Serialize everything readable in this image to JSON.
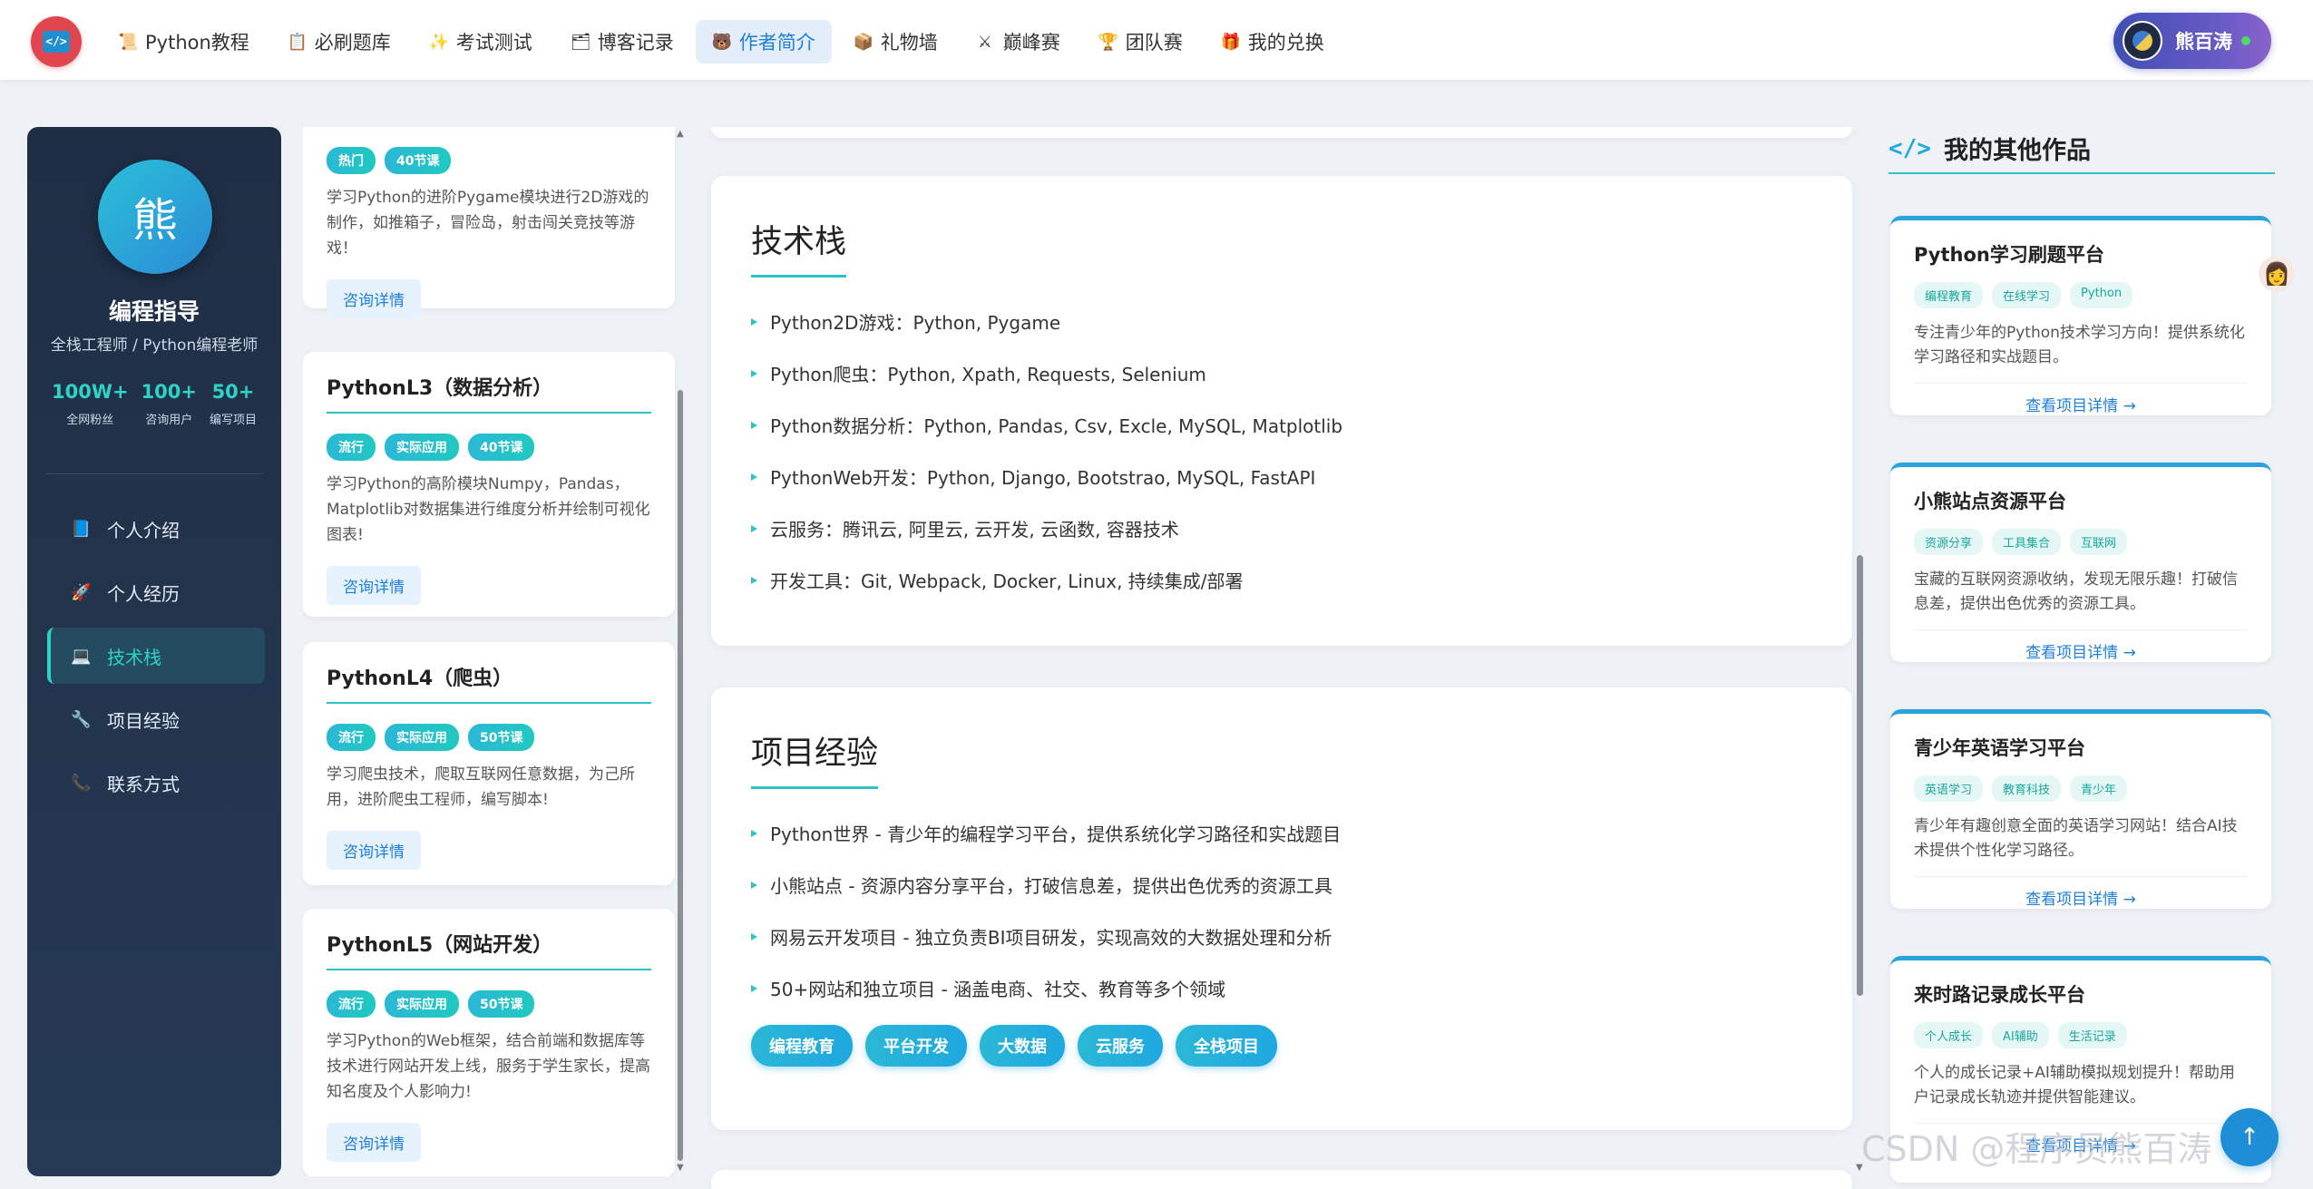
{
  "nav": {
    "logo": "</>",
    "items": [
      {
        "label": "Python教程",
        "icon": "📜"
      },
      {
        "label": "必刷题库",
        "icon": "📋"
      },
      {
        "label": "考试测试",
        "icon": "✨"
      },
      {
        "label": "博客记录",
        "icon": "🗂"
      },
      {
        "label": "作者简介",
        "icon": "🐻"
      },
      {
        "label": "礼物墙",
        "icon": "📦"
      },
      {
        "label": "巅峰赛",
        "icon": "⚔"
      },
      {
        "label": "团队赛",
        "icon": "🏆"
      },
      {
        "label": "我的兑换",
        "icon": "🎁"
      }
    ],
    "active_index": 4,
    "user_name": "熊百涛"
  },
  "profile": {
    "avatar_char": "熊",
    "name": "编程指导",
    "title": "全栈工程师 / Python编程老师",
    "stats": [
      {
        "num": "100W+",
        "label": "全网粉丝"
      },
      {
        "num": "100+",
        "label": "咨询用户"
      },
      {
        "num": "50+",
        "label": "编写项目"
      }
    ],
    "menu": [
      {
        "label": "个人介绍",
        "icon": "📘"
      },
      {
        "label": "个人经历",
        "icon": "🚀"
      },
      {
        "label": "技术栈",
        "icon": "💻"
      },
      {
        "label": "项目经验",
        "icon": "🔧"
      },
      {
        "label": "联系方式",
        "icon": "📞"
      }
    ],
    "active_menu": 2
  },
  "courses": {
    "partial": {
      "tags": [
        "热门",
        "40节课"
      ],
      "desc": "学习Python的进阶Pygame模块进行2D游戏的制作，如推箱子，冒险岛，射击闯关竞技等游戏！",
      "button": "咨询详情"
    },
    "items": [
      {
        "title": "PythonL3（数据分析）",
        "tags": [
          "流行",
          "实际应用",
          "40节课"
        ],
        "desc": "学习Python的高阶模块Numpy，Pandas，Matplotlib对数据集进行维度分析并绘制可视化图表!",
        "button": "咨询详情"
      },
      {
        "title": "PythonL4（爬虫）",
        "tags": [
          "流行",
          "实际应用",
          "50节课"
        ],
        "desc": "学习爬虫技术，爬取互联网任意数据，为己所用，进阶爬虫工程师，编写脚本!",
        "button": "咨询详情"
      },
      {
        "title": "PythonL5（网站开发）",
        "tags": [
          "流行",
          "实际应用",
          "50节课"
        ],
        "desc": "学习Python的Web框架，结合前端和数据库等技术进行网站开发上线，服务于学生家长，提高知名度及个人影响力!",
        "button": "咨询详情"
      }
    ]
  },
  "tech": {
    "title": "技术栈",
    "items": [
      "Python2D游戏：Python, Pygame",
      "Python爬虫：Python, Xpath, Requests, Selenium",
      "Python数据分析：Python, Pandas, Csv, Excle, MySQL, Matplotlib",
      "PythonWeb开发：Python, Django, Bootstrao, MySQL, FastAPI",
      "云服务：腾讯云, 阿里云, 云开发, 云函数, 容器技术",
      "开发工具：Git, Webpack, Docker, Linux, 持续集成/部署"
    ]
  },
  "projects": {
    "title": "项目经验",
    "items": [
      "Python世界 - 青少年的编程学习平台，提供系统化学习路径和实战题目",
      "小熊站点 - 资源内容分享平台，打破信息差，提供出色优秀的资源工具",
      "网易云开发项目 - 独立负责BI项目研发，实现高效的大数据处理和分析",
      "50+网站和独立项目 - 涵盖电商、社交、教育等多个领域"
    ],
    "tags": [
      "编程教育",
      "平台开发",
      "大数据",
      "云服务",
      "全栈项目"
    ]
  },
  "works": {
    "title": "我的其他作品",
    "icon": "</>",
    "items": [
      {
        "title": "Python学习刷题平台",
        "tags": [
          "编程教育",
          "在线学习",
          "Python"
        ],
        "desc": "专注青少年的Python技术学习方向！提供系统化学习路径和实战题目。",
        "link": "查看项目详情 →"
      },
      {
        "title": "小熊站点资源平台",
        "tags": [
          "资源分享",
          "工具集合",
          "互联网"
        ],
        "desc": "宝藏的互联网资源收纳，发现无限乐趣！打破信息差，提供出色优秀的资源工具。",
        "link": "查看项目详情 →"
      },
      {
        "title": "青少年英语学习平台",
        "tags": [
          "英语学习",
          "教育科技",
          "青少年"
        ],
        "desc": "青少年有趣创意全面的英语学习网站！结合AI技术提供个性化学习路径。",
        "link": "查看项目详情 →"
      },
      {
        "title": "来时路记录成长平台",
        "tags": [
          "个人成长",
          "AI辅助",
          "生活记录"
        ],
        "desc": "个人的成长记录+AI辅助模拟规划提升！帮助用户记录成长轨迹并提供智能建议。",
        "link": "查看项目详情 →"
      }
    ]
  },
  "watermark": "CSDN @程序员熊百涛",
  "float_button": "↑"
}
